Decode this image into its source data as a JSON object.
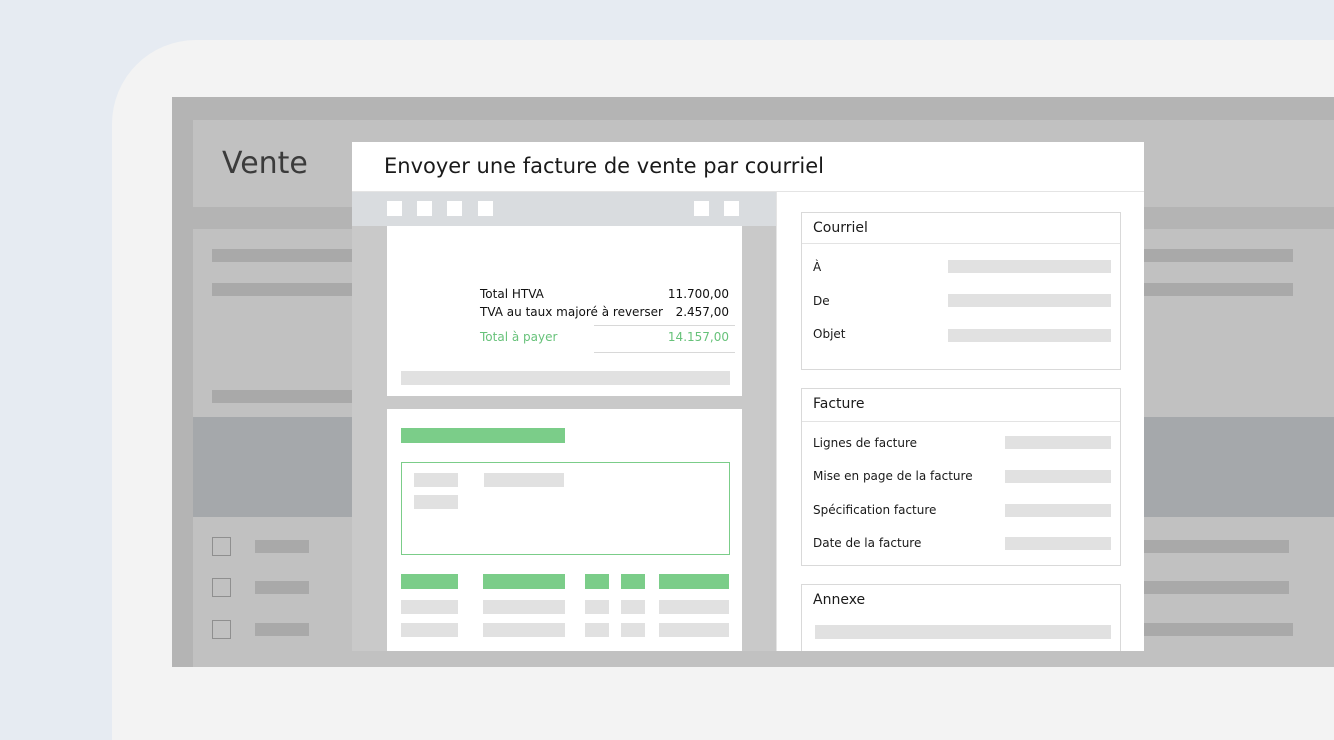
{
  "background_app": {
    "page_title": "Vente"
  },
  "modal": {
    "title": "Envoyer une facture de vente par courriel"
  },
  "invoice_preview": {
    "summary": [
      {
        "label": "Total HTVA",
        "value": "11.700,00"
      },
      {
        "label": "TVA au taux majoré à reverser",
        "value": "2.457,00"
      }
    ],
    "total": {
      "label": "Total à payer",
      "value": "14.157,00"
    }
  },
  "email_section": {
    "title": "Courriel",
    "fields": [
      {
        "label": "À"
      },
      {
        "label": "De"
      },
      {
        "label": "Objet"
      }
    ]
  },
  "invoice_section": {
    "title": "Facture",
    "fields": [
      {
        "label": "Lignes de facture"
      },
      {
        "label": "Mise en page de la facture"
      },
      {
        "label": "Spécification facture"
      },
      {
        "label": "Date de la facture"
      }
    ]
  },
  "attachment_section": {
    "title": "Annexe"
  },
  "colors": {
    "accent_green": "#7bcd89",
    "total_green": "#67c27a",
    "background": "#e6ebf2",
    "overlay_gray": "#b4b4b4"
  }
}
